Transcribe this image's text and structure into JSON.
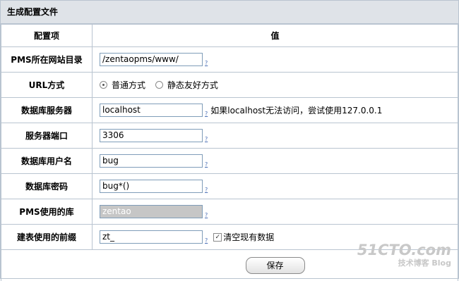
{
  "panel": {
    "title": "生成配置文件"
  },
  "table": {
    "header_item": "配置项",
    "header_value": "值"
  },
  "help_link": "?",
  "fields": {
    "webdir": {
      "label": "PMS所在网站目录",
      "value": "/zentaopms/www/"
    },
    "url_mode": {
      "label": "URL方式",
      "option1": "普通方式",
      "option2": "静态友好方式",
      "selected": "普通方式"
    },
    "db_host": {
      "label": "数据库服务器",
      "value": "localhost",
      "note": "如果localhost无法访问，尝试使用127.0.0.1"
    },
    "db_port": {
      "label": "服务器端口",
      "value": "3306"
    },
    "db_user": {
      "label": "数据库用户名",
      "value": "bug"
    },
    "db_password": {
      "label": "数据库密码",
      "value": "bug*()"
    },
    "db_name": {
      "label": "PMS使用的库",
      "value": "zentao"
    },
    "prefix": {
      "label": "建表使用的前缀",
      "value": "zt_",
      "clear_label": "清空现有数据",
      "clear_checked": true
    }
  },
  "actions": {
    "save_label": "保存"
  },
  "watermark": {
    "site": "51CTO.com",
    "sub": "技术博客 Blog"
  }
}
